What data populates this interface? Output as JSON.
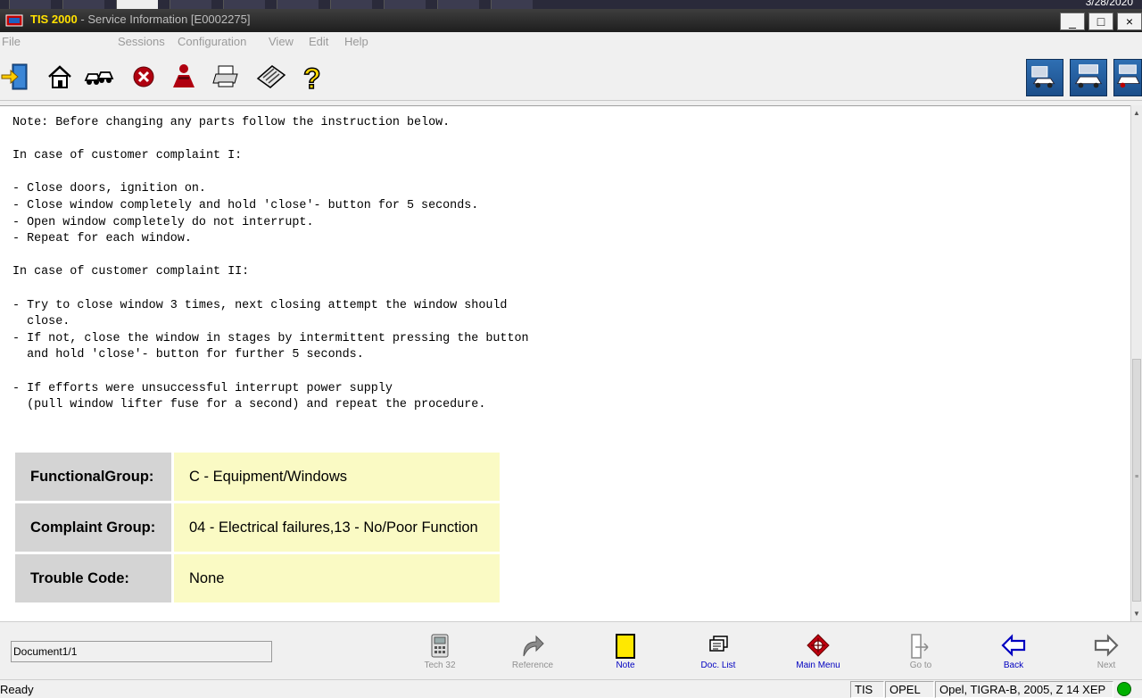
{
  "taskbar": {
    "date": "3/28/2020"
  },
  "window": {
    "app_name": "TIS 2000",
    "title_rest": " - Service Information [E0002275]",
    "controls": {
      "minimize": "_",
      "maximize": "□",
      "close": "×"
    }
  },
  "menu": {
    "items": [
      "File",
      "Sessions",
      "Configuration",
      "View",
      "Edit",
      "Help"
    ]
  },
  "toolbar": {
    "icons": [
      "exit-door-icon",
      "home-icon",
      "vehicles-icon",
      "stop-icon",
      "user-icon",
      "printer-icon",
      "keyboard-icon",
      "help-icon"
    ],
    "right_icons": [
      "vehicle-diagnostics-icon",
      "vehicle-service-icon",
      "vehicle-repair-icon"
    ]
  },
  "content": {
    "note_lines": [
      "Note: Before changing any parts follow the instruction below.",
      "",
      "In case of customer complaint I:",
      "",
      "- Close doors, ignition on.",
      "- Close window completely and hold 'close'- button for 5 seconds.",
      "- Open window completely do not interrupt.",
      "- Repeat for each window.",
      "",
      "In case of customer complaint II:",
      "",
      "- Try to close window 3 times, next closing attempt the window should",
      "  close.",
      "- If not, close the window in stages by intermittent pressing the button",
      "  and hold 'close'- button for further 5 seconds.",
      "",
      "- If efforts were unsuccessful interrupt power supply",
      "  (pull window lifter fuse for a second) and repeat the procedure."
    ],
    "info_table": [
      {
        "label": "FunctionalGroup:",
        "value": "C - Equipment/Windows"
      },
      {
        "label": "Complaint Group:",
        "value": "04 - Electrical failures,13 - No/Poor Function"
      },
      {
        "label": "Trouble Code:",
        "value": "None"
      }
    ]
  },
  "navbar": {
    "document": "Document1/1",
    "buttons": [
      {
        "label": "Tech 32",
        "icon": "tech32-device-icon",
        "color": "#909090"
      },
      {
        "label": "Reference",
        "icon": "reference-arrow-icon",
        "color": "#909090"
      },
      {
        "label": "Note",
        "icon": "note-icon",
        "color": "#0000c0"
      },
      {
        "label": "Doc. List",
        "icon": "doc-list-icon",
        "color": "#0000c0"
      },
      {
        "label": "Main Menu",
        "icon": "main-menu-icon",
        "color": "#0000c0"
      },
      {
        "label": "Go to",
        "icon": "goto-icon",
        "color": "#909090"
      },
      {
        "label": "Back",
        "icon": "back-arrow-icon",
        "color": "#0000c0"
      },
      {
        "label": "Next",
        "icon": "next-arrow-icon",
        "color": "#909090"
      }
    ]
  },
  "statusbar": {
    "ready": "Ready",
    "system": "TIS",
    "make": "OPEL",
    "vehicle": "Opel, TIGRA-B, 2005, Z 14 XEP",
    "led_color": "#00b000"
  }
}
